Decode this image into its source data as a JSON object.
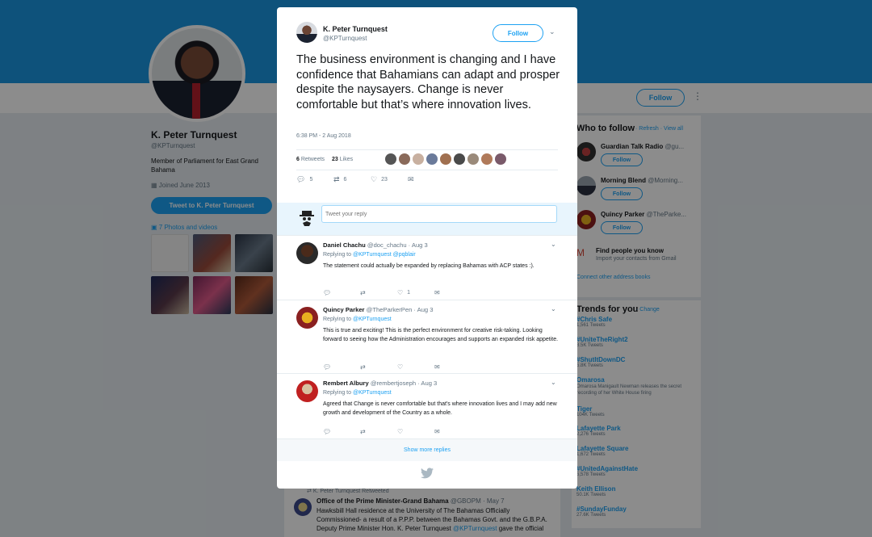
{
  "profile": {
    "name": "K. Peter Turnquest",
    "handle": "@KPTurnquest",
    "bio": "Member of Parliament for East Grand Bahama",
    "joined": "Joined June 2013",
    "tweet_to_label": "Tweet to K. Peter Turnquest",
    "photos_label": "7 Photos and videos",
    "follow_label": "Follow"
  },
  "who_to_follow": {
    "title": "Who to follow",
    "sub": "· Refresh · View all",
    "users": [
      {
        "name": "Guardian Talk Radio",
        "handle": "@gu...",
        "follow_label": "Follow"
      },
      {
        "name": "Morning Blend",
        "handle": "@Morning...",
        "follow_label": "Follow"
      },
      {
        "name": "Quincy Parker",
        "handle": "@TheParke...",
        "follow_label": "Follow"
      }
    ],
    "find_title": "Find people you know",
    "find_sub": "Import your contacts from Gmail",
    "connect": "Connect other address books"
  },
  "trends": {
    "title": "Trends for you",
    "change": "· Change",
    "items": [
      {
        "name": "#Chris Safe",
        "count": "1,561 Tweets"
      },
      {
        "name": "#UniteTheRight2",
        "count": "8.5K Tweets"
      },
      {
        "name": "#ShutItDownDC",
        "count": "5.8K Tweets"
      },
      {
        "name": "Omarosa",
        "count": "Omarosa Manigault Newman releases the secret recording of her White House firing"
      },
      {
        "name": "Tiger",
        "count": "104K Tweets"
      },
      {
        "name": "Lafayette Park",
        "count": "2,276 Tweets"
      },
      {
        "name": "Lafayette Square",
        "count": "1,672 Tweets"
      },
      {
        "name": "#UnitedAgainstHate",
        "count": "5,578 Tweets"
      },
      {
        "name": "Keith Ellison",
        "count": "50.1K Tweets"
      },
      {
        "name": "#SundayFunday",
        "count": "27.6K Tweets"
      }
    ]
  },
  "timeline": {
    "retweeted": "K. Peter Turnquest Retweeted",
    "name": "Office of the Prime Minister-Grand Bahama",
    "meta": "@GBOPM · May 7",
    "body_1": "Hawksbill Hall residence at the University of The Bahamas Officially Commissioned- a result of a P.P.P. between the Bahamas Govt. and the G.B.P.A. Deputy Prime Minister Hon. K. Peter Turnquest",
    "body_link": "@KPTurnquest",
    "body_2": "gave the official"
  },
  "tweet": {
    "name": "K. Peter Turnquest",
    "handle": "@KPTurnquest",
    "follow_label": "Follow",
    "text": "The business environment is changing and I have confidence that Bahamians can adapt and prosper despite the naysayers.  Change is never comfortable but that’s where innovation lives.",
    "time": "6:38 PM - 2 Aug 2018",
    "retweets": "6",
    "retweets_label": "Retweets",
    "likes": "23",
    "likes_label": "Likes",
    "reply_count": "5",
    "retweet_count": "6",
    "like_count": "23"
  },
  "reply_box": {
    "placeholder": "Tweet your reply"
  },
  "replies": [
    {
      "name": "Daniel Chachu",
      "handle": "@doc_chachu",
      "date": "· Aug 3",
      "replying": "Replying to",
      "to": "@KPTurnquest @pqblair",
      "body": "The statement could actually be expanded by replacing Bahamas with ACP states :).",
      "likes": "1"
    },
    {
      "name": "Quincy Parker",
      "handle": "@TheParkerPen",
      "date": "· Aug 3",
      "replying": "Replying to",
      "to": "@KPTurnquest",
      "body": "This is true and exciting! This is the perfect environment for creative risk-taking. Looking forward to seeing how the Administration encourages and supports an expanded risk appetite.",
      "likes": ""
    },
    {
      "name": "Rembert Albury",
      "handle": "@rembertjoseph",
      "date": "· Aug 3",
      "replying": "Replying to",
      "to": "@KPTurnquest",
      "body": "Agreed that Change is never comfortable but that's where innovation lives and I may add new growth and development of the Country as a whole.",
      "likes": ""
    }
  ],
  "show_more": "Show more replies",
  "colors": {
    "accent": "#1da1f2",
    "banner": "#1b95e0",
    "bg": "#e6ecf0"
  }
}
